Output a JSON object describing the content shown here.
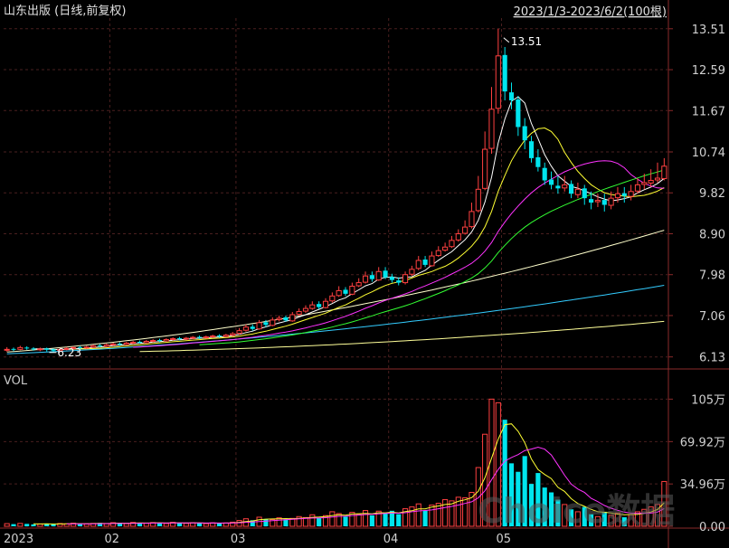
{
  "title": "山东出版 (日线,前复权)",
  "date_range": "2023/1/3-2023/6/2(100根)",
  "watermark": "Choice数据",
  "colors": {
    "background": "#000000",
    "up": "#ff4040",
    "down": "#00e5ee",
    "grid": "#4a1f1f",
    "axis_text": "#d0d0d0",
    "ma5": "#ffffff",
    "ma10": "#ffff33",
    "ma20": "#ff33ff",
    "ma30": "#33ff33",
    "ma60": "#ffffcc",
    "ma120": "#33ccff",
    "ma250": "#ffff99"
  },
  "chart_data": [
    {
      "type": "candlestick",
      "name": "price",
      "ylim": [
        5.9,
        13.75
      ],
      "y_ticks": [
        "13.51",
        "12.59",
        "11.67",
        "10.74",
        "9.82",
        "8.90",
        "7.98",
        "7.06",
        "6.13"
      ],
      "x_month_labels": [
        {
          "label": "2023",
          "index": 0
        },
        {
          "label": "02",
          "index": 16
        },
        {
          "label": "03",
          "index": 35
        },
        {
          "label": "04",
          "index": 58
        },
        {
          "label": "05",
          "index": 75
        }
      ],
      "annotations": [
        {
          "text": "13.51",
          "marker": "high",
          "index": 74,
          "value": 13.51
        },
        {
          "text": "6.23",
          "marker": "low",
          "index": 8,
          "value": 6.23
        }
      ],
      "close": [
        6.3,
        6.29,
        6.34,
        6.32,
        6.3,
        6.31,
        6.29,
        6.27,
        6.3,
        6.32,
        6.34,
        6.33,
        6.35,
        6.38,
        6.37,
        6.4,
        6.42,
        6.41,
        6.44,
        6.46,
        6.45,
        6.48,
        6.5,
        6.49,
        6.52,
        6.54,
        6.53,
        6.55,
        6.57,
        6.56,
        6.58,
        6.6,
        6.59,
        6.62,
        6.65,
        6.72,
        6.8,
        6.76,
        6.9,
        6.85,
        6.96,
        7.0,
        6.95,
        7.08,
        7.15,
        7.22,
        7.3,
        7.25,
        7.38,
        7.5,
        7.62,
        7.55,
        7.72,
        7.8,
        7.95,
        7.88,
        8.05,
        7.92,
        7.86,
        7.8,
        7.98,
        8.1,
        8.3,
        8.2,
        8.4,
        8.52,
        8.6,
        8.75,
        8.9,
        9.05,
        9.4,
        9.9,
        10.8,
        11.7,
        12.9,
        12.1,
        11.9,
        11.3,
        11.0,
        10.6,
        10.4,
        10.1,
        10.0,
        9.92,
        10.0,
        9.8,
        9.9,
        9.7,
        9.6,
        9.65,
        9.55,
        9.7,
        9.8,
        9.75,
        9.85,
        10.0,
        10.05,
        10.1,
        10.15,
        10.42
      ],
      "open": [
        6.28,
        6.31,
        6.3,
        6.34,
        6.32,
        6.29,
        6.32,
        6.3,
        6.27,
        6.3,
        6.32,
        6.35,
        6.33,
        6.35,
        6.39,
        6.37,
        6.4,
        6.43,
        6.41,
        6.44,
        6.47,
        6.45,
        6.48,
        6.51,
        6.49,
        6.52,
        6.55,
        6.53,
        6.55,
        6.58,
        6.56,
        6.58,
        6.61,
        6.59,
        6.62,
        6.66,
        6.73,
        6.81,
        6.76,
        6.91,
        6.84,
        6.97,
        7.02,
        6.94,
        7.09,
        7.16,
        7.22,
        7.32,
        7.24,
        7.39,
        7.51,
        7.64,
        7.54,
        7.73,
        7.81,
        7.97,
        7.86,
        8.07,
        7.93,
        7.85,
        7.8,
        7.99,
        8.12,
        8.32,
        8.18,
        8.41,
        8.53,
        8.61,
        8.76,
        8.91,
        9.06,
        9.42,
        9.92,
        10.82,
        11.72,
        12.92,
        12.08,
        11.92,
        11.32,
        10.98,
        10.62,
        10.38,
        10.12,
        9.98,
        9.93,
        10.02,
        9.78,
        9.92,
        9.68,
        9.62,
        9.66,
        9.54,
        9.71,
        9.81,
        9.74,
        9.86,
        10.01,
        10.04,
        10.11,
        10.14
      ],
      "high": [
        6.35,
        6.34,
        6.38,
        6.37,
        6.35,
        6.34,
        6.34,
        6.32,
        6.33,
        6.35,
        6.37,
        6.38,
        6.38,
        6.41,
        6.42,
        6.43,
        6.45,
        6.46,
        6.47,
        6.49,
        6.5,
        6.51,
        6.53,
        6.54,
        6.55,
        6.57,
        6.58,
        6.58,
        6.6,
        6.61,
        6.61,
        6.63,
        6.64,
        6.65,
        6.69,
        6.78,
        6.86,
        6.86,
        6.96,
        6.96,
        7.02,
        7.06,
        7.06,
        7.14,
        7.22,
        7.29,
        7.38,
        7.38,
        7.45,
        7.58,
        7.72,
        7.7,
        7.8,
        7.9,
        8.05,
        8.05,
        8.15,
        8.15,
        8.0,
        7.92,
        8.05,
        8.18,
        8.4,
        8.4,
        8.5,
        8.62,
        8.7,
        8.85,
        9.0,
        9.2,
        9.6,
        10.2,
        11.2,
        12.2,
        13.51,
        13.1,
        12.3,
        12.0,
        11.5,
        11.1,
        10.8,
        10.5,
        10.3,
        10.2,
        10.2,
        10.1,
        10.05,
        10.0,
        9.85,
        9.8,
        9.8,
        9.85,
        9.95,
        9.95,
        10.0,
        10.15,
        10.25,
        10.35,
        10.5,
        10.6
      ],
      "low": [
        6.25,
        6.26,
        6.28,
        6.29,
        6.27,
        6.26,
        6.25,
        6.23,
        6.25,
        6.28,
        6.3,
        6.3,
        6.31,
        6.33,
        6.35,
        6.35,
        6.38,
        6.38,
        6.39,
        6.42,
        6.43,
        6.43,
        6.46,
        6.46,
        6.47,
        6.5,
        6.5,
        6.51,
        6.53,
        6.53,
        6.54,
        6.56,
        6.56,
        6.57,
        6.59,
        6.63,
        6.7,
        6.72,
        6.74,
        6.8,
        6.82,
        6.93,
        6.92,
        6.92,
        7.05,
        7.12,
        7.19,
        7.2,
        7.22,
        7.35,
        7.48,
        7.5,
        7.52,
        7.7,
        7.78,
        7.82,
        7.84,
        7.88,
        7.8,
        7.74,
        7.76,
        7.95,
        8.08,
        8.15,
        8.16,
        8.38,
        8.5,
        8.58,
        8.72,
        8.88,
        9.02,
        9.38,
        9.88,
        10.7,
        11.6,
        11.9,
        11.7,
        11.1,
        10.8,
        10.5,
        10.3,
        10.0,
        9.9,
        9.8,
        9.85,
        9.7,
        9.7,
        9.55,
        9.45,
        9.5,
        9.4,
        9.45,
        9.6,
        9.6,
        9.65,
        9.8,
        9.9,
        9.95,
        10.05,
        10.1
      ],
      "moving_averages": [
        {
          "window": 5,
          "color_key": "ma5"
        },
        {
          "window": 10,
          "color_key": "ma10"
        },
        {
          "window": 20,
          "color_key": "ma20"
        },
        {
          "window": 30,
          "color_key": "ma30"
        }
      ],
      "long_averages": [
        {
          "color_key": "ma60",
          "x": [
            0,
            99
          ],
          "y": [
            6.24,
            8.98
          ]
        },
        {
          "color_key": "ma120",
          "x": [
            0,
            99
          ],
          "y": [
            6.2,
            7.74
          ]
        },
        {
          "color_key": "ma250",
          "x": [
            20,
            99
          ],
          "y": [
            6.25,
            6.93
          ]
        }
      ]
    },
    {
      "type": "bar",
      "name": "VOL",
      "label": "VOL",
      "ylim": [
        0,
        112
      ],
      "y_ticks": [
        "105万",
        "69.92万",
        "34.96万",
        "0.00"
      ],
      "values": [
        2.2,
        1.8,
        2.4,
        2.0,
        1.6,
        1.9,
        2.1,
        1.7,
        2.3,
        2.0,
        2.6,
        2.2,
        1.9,
        2.4,
        2.8,
        2.1,
        3.0,
        2.6,
        2.2,
        3.2,
        2.9,
        2.5,
        3.1,
        2.7,
        2.3,
        3.3,
        2.8,
        2.4,
        3.0,
        2.6,
        2.2,
        2.9,
        2.5,
        2.8,
        3.4,
        4.8,
        6.2,
        5.0,
        7.5,
        6.0,
        5.5,
        7.0,
        5.8,
        6.5,
        8.0,
        7.2,
        9.5,
        6.8,
        8.8,
        12.0,
        10.5,
        8.0,
        11.5,
        10.0,
        13.0,
        9.0,
        12.5,
        11.0,
        12.8,
        10.0,
        14.5,
        16.0,
        18.5,
        13.0,
        17.5,
        19.0,
        22.0,
        21.0,
        24.0,
        23.5,
        28.0,
        48.5,
        76.0,
        105.0,
        102.0,
        88.0,
        52.0,
        45.0,
        58.0,
        35.0,
        44.0,
        32.0,
        28.0,
        22.0,
        18.0,
        14.0,
        12.0,
        16.0,
        10.0,
        8.0,
        12.0,
        9.0,
        11.0,
        7.5,
        9.5,
        12.0,
        14.0,
        16.0,
        18.0,
        37.0
      ],
      "moving_averages": [
        {
          "window": 5,
          "color_key": "ma10"
        },
        {
          "window": 10,
          "color_key": "ma20"
        }
      ]
    }
  ]
}
